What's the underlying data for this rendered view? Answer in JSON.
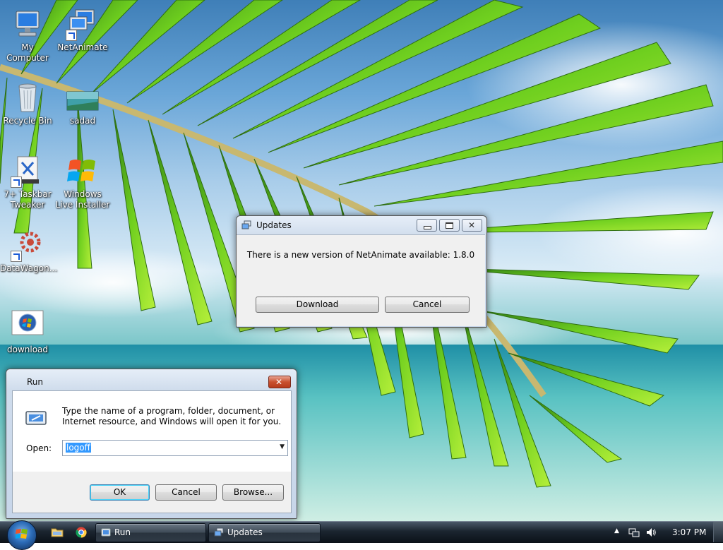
{
  "desktop": {
    "icons": [
      {
        "label": "My Computer"
      },
      {
        "label": "NetAnimate"
      },
      {
        "label": "Recycle Bin"
      },
      {
        "label": "sadad"
      },
      {
        "label": "7+ Taskbar Tweaker"
      },
      {
        "label": "Windows Live Installer"
      },
      {
        "label": "DataWagon..."
      },
      {
        "label": "download"
      }
    ]
  },
  "updates_dialog": {
    "title": "Updates",
    "message": "There is a new version of NetAnimate available: 1.8.0",
    "download_label": "Download",
    "cancel_label": "Cancel"
  },
  "run_dialog": {
    "title": "Run",
    "description": "Type the name of a program, folder, document, or Internet resource, and Windows will open it for you.",
    "open_label": "Open:",
    "open_value": "logoff",
    "ok_label": "OK",
    "cancel_label": "Cancel",
    "browse_label": "Browse..."
  },
  "taskbar": {
    "buttons": [
      {
        "label": "Run"
      },
      {
        "label": "Updates"
      }
    ],
    "clock": "3:07 PM"
  },
  "colors": {
    "selection": "#3399ff",
    "close_button": "#c9502f",
    "taskbar": "#1b2530"
  }
}
